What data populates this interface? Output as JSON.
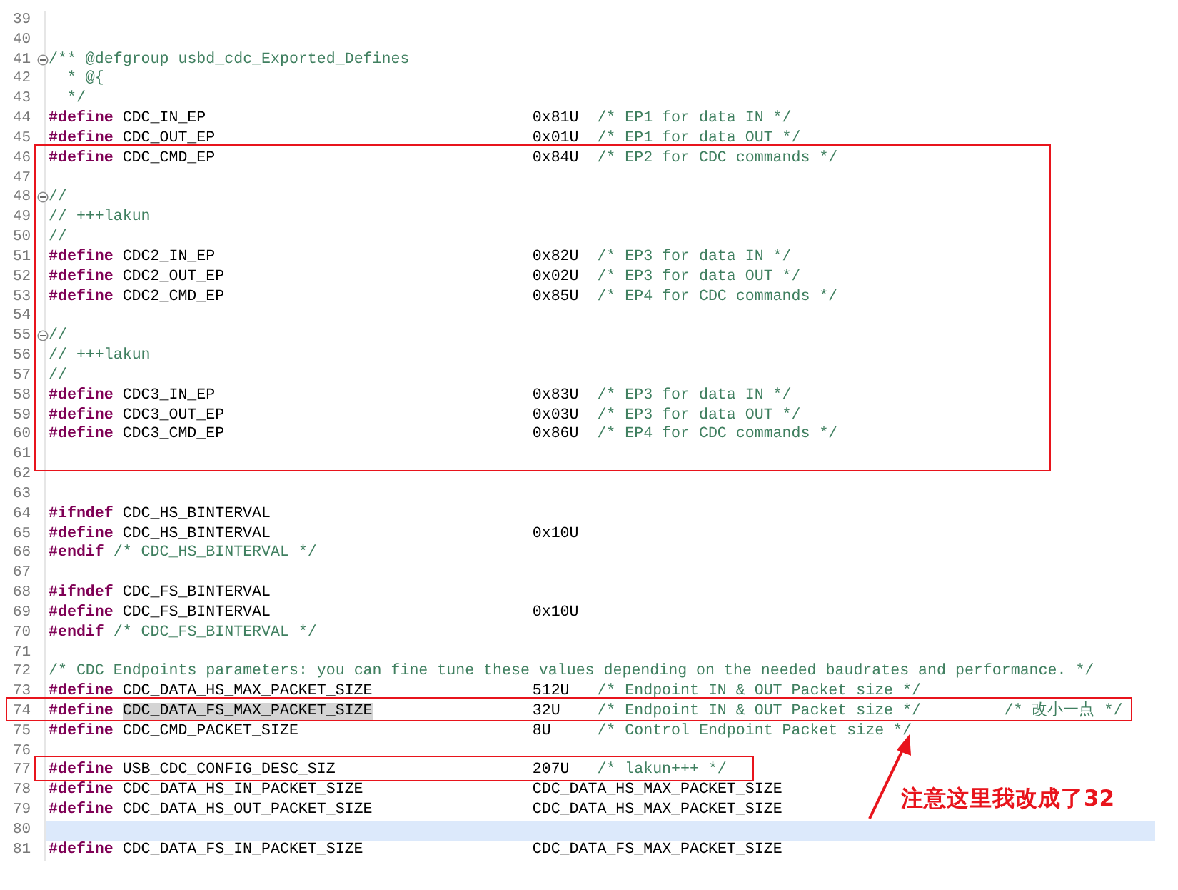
{
  "lines": [
    {
      "number": "39",
      "kind": "blank",
      "fold": false,
      "current": false
    },
    {
      "number": "40",
      "kind": "blank",
      "fold": false,
      "current": false
    },
    {
      "number": "41",
      "kind": "comment",
      "text": "/** @defgroup usbd_cdc_Exported_Defines",
      "fold": true,
      "current": false
    },
    {
      "number": "42",
      "kind": "comment",
      "text": "  * @{",
      "fold": false,
      "current": false
    },
    {
      "number": "43",
      "kind": "comment",
      "text": "  */",
      "fold": false,
      "current": false
    },
    {
      "number": "44",
      "kind": "define",
      "keyword": "#define",
      "name": "CDC_IN_EP",
      "value": "0x81U",
      "comment": "/* EP1 for data IN */",
      "fold": false,
      "current": false,
      "marked": false
    },
    {
      "number": "45",
      "kind": "define",
      "keyword": "#define",
      "name": "CDC_OUT_EP",
      "value": "0x01U",
      "comment": "/* EP1 for data OUT */",
      "fold": false,
      "current": false,
      "marked": false
    },
    {
      "number": "46",
      "kind": "define",
      "keyword": "#define",
      "name": "CDC_CMD_EP",
      "value": "0x84U",
      "comment": "/* EP2 for CDC commands */",
      "fold": false,
      "current": false,
      "marked": false
    },
    {
      "number": "47",
      "kind": "blank",
      "fold": false,
      "current": false
    },
    {
      "number": "48",
      "kind": "comment",
      "text": "//",
      "fold": true,
      "current": false
    },
    {
      "number": "49",
      "kind": "comment",
      "text": "// +++lakun",
      "fold": false,
      "current": false
    },
    {
      "number": "50",
      "kind": "comment",
      "text": "//",
      "fold": false,
      "current": false
    },
    {
      "number": "51",
      "kind": "define",
      "keyword": "#define",
      "name": "CDC2_IN_EP",
      "value": "0x82U",
      "comment": "/* EP3 for data IN */",
      "fold": false,
      "current": false,
      "marked": false
    },
    {
      "number": "52",
      "kind": "define",
      "keyword": "#define",
      "name": "CDC2_OUT_EP",
      "value": "0x02U",
      "comment": "/* EP3 for data OUT */",
      "fold": false,
      "current": false,
      "marked": false
    },
    {
      "number": "53",
      "kind": "define",
      "keyword": "#define",
      "name": "CDC2_CMD_EP",
      "value": "0x85U",
      "comment": "/* EP4 for CDC commands */",
      "fold": false,
      "current": false,
      "marked": false
    },
    {
      "number": "54",
      "kind": "blank",
      "fold": false,
      "current": false
    },
    {
      "number": "55",
      "kind": "comment",
      "text": "//",
      "fold": true,
      "current": false
    },
    {
      "number": "56",
      "kind": "comment",
      "text": "// +++lakun",
      "fold": false,
      "current": false
    },
    {
      "number": "57",
      "kind": "comment",
      "text": "//",
      "fold": false,
      "current": false
    },
    {
      "number": "58",
      "kind": "define",
      "keyword": "#define",
      "name": "CDC3_IN_EP",
      "value": "0x83U",
      "comment": "/* EP3 for data IN */",
      "fold": false,
      "current": false,
      "marked": false
    },
    {
      "number": "59",
      "kind": "define",
      "keyword": "#define",
      "name": "CDC3_OUT_EP",
      "value": "0x03U",
      "comment": "/* EP3 for data OUT */",
      "fold": false,
      "current": false,
      "marked": false
    },
    {
      "number": "60",
      "kind": "define",
      "keyword": "#define",
      "name": "CDC3_CMD_EP",
      "value": "0x86U",
      "comment": "/* EP4 for CDC commands */",
      "fold": false,
      "current": false,
      "marked": false
    },
    {
      "number": "61",
      "kind": "blank",
      "fold": false,
      "current": false
    },
    {
      "number": "62",
      "kind": "blank",
      "fold": false,
      "current": false
    },
    {
      "number": "63",
      "kind": "blank",
      "fold": false,
      "current": false
    },
    {
      "number": "64",
      "kind": "directive",
      "keyword": "#ifndef",
      "name": "CDC_HS_BINTERVAL",
      "fold": false,
      "current": false
    },
    {
      "number": "65",
      "kind": "define",
      "keyword": "#define",
      "name": "CDC_HS_BINTERVAL",
      "value": "0x10U",
      "fold": false,
      "current": false,
      "marked": false
    },
    {
      "number": "66",
      "kind": "directive",
      "keyword": "#endif",
      "comment": "/* CDC_HS_BINTERVAL */",
      "fold": false,
      "current": false
    },
    {
      "number": "67",
      "kind": "blank",
      "fold": false,
      "current": false
    },
    {
      "number": "68",
      "kind": "directive",
      "keyword": "#ifndef",
      "name": "CDC_FS_BINTERVAL",
      "fold": false,
      "current": false
    },
    {
      "number": "69",
      "kind": "define",
      "keyword": "#define",
      "name": "CDC_FS_BINTERVAL",
      "value": "0x10U",
      "fold": false,
      "current": false,
      "marked": false
    },
    {
      "number": "70",
      "kind": "directive",
      "keyword": "#endif",
      "comment": "/* CDC_FS_BINTERVAL */",
      "fold": false,
      "current": false
    },
    {
      "number": "71",
      "kind": "blank",
      "fold": false,
      "current": false
    },
    {
      "number": "72",
      "kind": "comment",
      "text": "/* CDC Endpoints parameters: you can fine tune these values depending on the needed baudrates and performance. */",
      "fold": false,
      "current": false
    },
    {
      "number": "73",
      "kind": "define",
      "keyword": "#define",
      "name": "CDC_DATA_HS_MAX_PACKET_SIZE",
      "value": "512U",
      "comment": "/* Endpoint IN & OUT Packet size */",
      "fold": false,
      "current": false,
      "marked": false
    },
    {
      "number": "74",
      "kind": "define",
      "keyword": "#define",
      "name": "CDC_DATA_FS_MAX_PACKET_SIZE",
      "value": "32U",
      "comment": "/* Endpoint IN & OUT Packet size */",
      "note": "/* 改小一点 */",
      "fold": false,
      "current": false,
      "marked": true
    },
    {
      "number": "75",
      "kind": "define",
      "keyword": "#define",
      "name": "CDC_CMD_PACKET_SIZE",
      "value": "8U",
      "comment": "/* Control Endpoint Packet size */",
      "fold": false,
      "current": false,
      "marked": false
    },
    {
      "number": "76",
      "kind": "blank",
      "fold": false,
      "current": false
    },
    {
      "number": "77",
      "kind": "define",
      "keyword": "#define",
      "name": "USB_CDC_CONFIG_DESC_SIZ",
      "value": "207U",
      "comment": "/* lakun+++ */",
      "fold": false,
      "current": false,
      "marked": false
    },
    {
      "number": "78",
      "kind": "define",
      "keyword": "#define",
      "name": "CDC_DATA_HS_IN_PACKET_SIZE",
      "value": "CDC_DATA_HS_MAX_PACKET_SIZE",
      "fold": false,
      "current": false,
      "marked": false
    },
    {
      "number": "79",
      "kind": "define",
      "keyword": "#define",
      "name": "CDC_DATA_HS_OUT_PACKET_SIZE",
      "value": "CDC_DATA_HS_MAX_PACKET_SIZE",
      "fold": false,
      "current": false,
      "marked": false
    },
    {
      "number": "80",
      "kind": "blank",
      "fold": false,
      "current": true
    },
    {
      "number": "81",
      "kind": "define",
      "keyword": "#define",
      "name": "CDC_DATA_FS_IN_PACKET_SIZE",
      "value": "CDC_DATA_FS_MAX_PACKET_SIZE",
      "fold": false,
      "current": false,
      "marked": false
    }
  ],
  "annotation": {
    "note": "注意这里我改成了32"
  }
}
